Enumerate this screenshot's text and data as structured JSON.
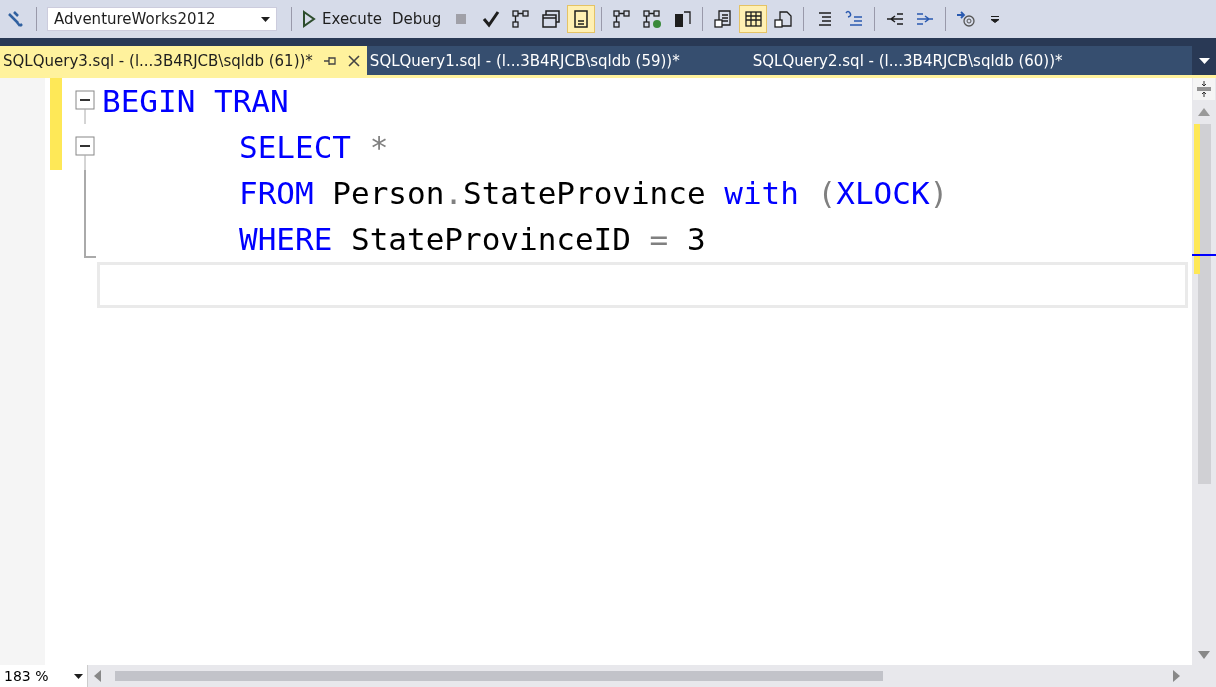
{
  "toolbar": {
    "database": "AdventureWorks2012",
    "items": [
      {
        "kind": "plug",
        "selected": false
      },
      {
        "kind": "database"
      },
      {
        "kind": "execute",
        "label": "Execute"
      },
      {
        "kind": "text",
        "label": "Debug"
      },
      {
        "kind": "stop",
        "selected": false
      },
      {
        "kind": "check",
        "selected": false
      },
      {
        "kind": "plan",
        "selected": false
      },
      {
        "kind": "window",
        "selected": false
      },
      {
        "kind": "form",
        "selected": true
      },
      {
        "kind": "sep"
      },
      {
        "kind": "plan",
        "selected": false
      },
      {
        "kind": "plancheck",
        "selected": false
      },
      {
        "kind": "server",
        "selected": false
      },
      {
        "kind": "sep"
      },
      {
        "kind": "text-result",
        "selected": false
      },
      {
        "kind": "grid-result",
        "selected": true
      },
      {
        "kind": "file-result",
        "selected": false
      },
      {
        "kind": "sep"
      },
      {
        "kind": "lines",
        "selected": false
      },
      {
        "kind": "help",
        "selected": false
      },
      {
        "kind": "sep"
      },
      {
        "kind": "outdent",
        "selected": false
      },
      {
        "kind": "indent",
        "selected": false
      },
      {
        "kind": "sep"
      },
      {
        "kind": "at",
        "selected": false
      },
      {
        "kind": "more",
        "selected": false
      }
    ]
  },
  "tabs": [
    {
      "label": "SQLQuery3.sql - (l...3B4RJCB\\sqldb (61))*",
      "selected": true
    },
    {
      "label": "SQLQuery1.sql - (l...3B4RJCB\\sqldb (59))*",
      "selected": false
    },
    {
      "label": "SQLQuery2.sql - (l...3B4RJCB\\sqldb (60))*",
      "selected": false
    }
  ],
  "editor": {
    "lines": [
      {
        "kind": "fold-start",
        "tokens": [
          {
            "kind": "keyword",
            "text": "BEGIN TRAN"
          }
        ],
        "children": [
          {
            "kind": "fold-start",
            "tokens": [
              {
                "kind": "keyword",
                "text": "SELECT"
              },
              {
                "kind": "op",
                "text": " *"
              }
            ]
          },
          {
            "kind": "fold-line",
            "tokens": [
              {
                "kind": "keyword",
                "text": "FROM"
              },
              {
                "kind": "plain",
                "text": " Person"
              },
              {
                "kind": "op",
                "text": "."
              },
              {
                "kind": "plain",
                "text": "StateProvince "
              },
              {
                "kind": "keyword",
                "text": "with"
              },
              {
                "kind": "op",
                "text": " ("
              },
              {
                "kind": "keyword",
                "text": "XLOCK"
              },
              {
                "kind": "op",
                "text": ")"
              }
            ]
          },
          {
            "kind": "fold-end",
            "tokens": [
              {
                "kind": "keyword",
                "text": "WHERE"
              },
              {
                "kind": "plain",
                "text": " StateProvinceID "
              },
              {
                "kind": "op",
                "text": "="
              },
              {
                "kind": "plain",
                "text": " 3"
              }
            ]
          }
        ]
      },
      {
        "kind": "blank",
        "current": true
      }
    ]
  },
  "zoom": "183 %"
}
